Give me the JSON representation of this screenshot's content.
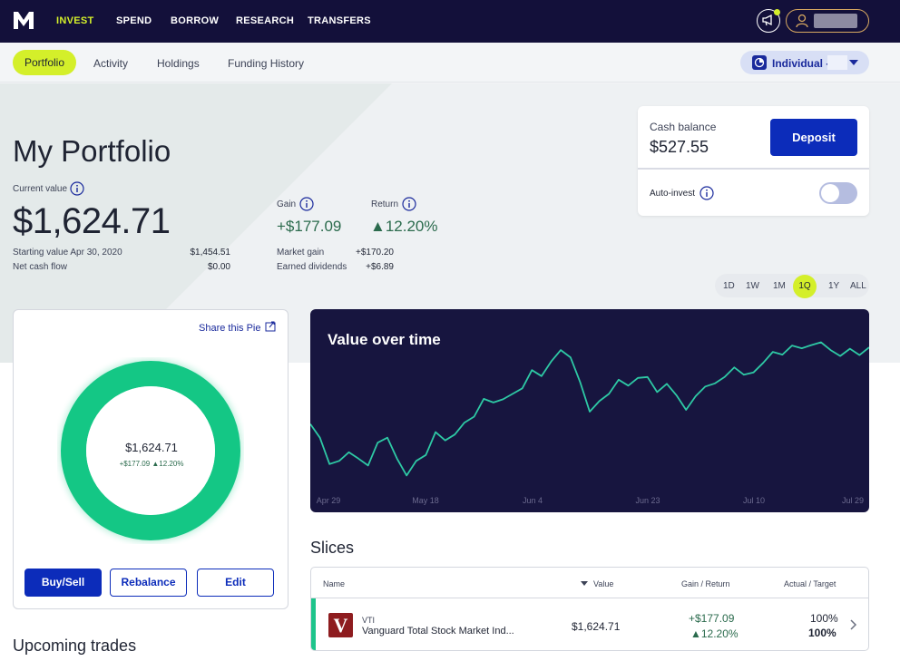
{
  "nav": {
    "logo": "M",
    "items": [
      "INVEST",
      "SPEND",
      "BORROW",
      "RESEARCH",
      "TRANSFERS"
    ],
    "accent": "#d4ef2a",
    "background": "#13103a"
  },
  "subnav": {
    "tabs": [
      "Portfolio",
      "Activity",
      "Holdings",
      "Funding History"
    ],
    "account": "Individual -"
  },
  "portfolio": {
    "title": "My Portfolio",
    "current_value_label": "Current value",
    "current_value": "$1,624.71",
    "starting_label": "Starting value Apr 30, 2020",
    "starting_value": "$1,454.51",
    "net_cash_label": "Net cash flow",
    "net_cash_value": "$0.00",
    "gain_label": "Gain",
    "gain_value": "+$177.09",
    "return_label": "Return",
    "return_value": "▲12.20%",
    "market_gain_label": "Market gain",
    "market_gain_value": "+$170.20",
    "dividends_label": "Earned dividends",
    "dividends_value": "+$6.89"
  },
  "cash": {
    "label": "Cash balance",
    "value": "$527.55",
    "deposit": "Deposit",
    "auto_invest": "Auto-invest",
    "auto_invest_on": false
  },
  "range": {
    "options": [
      "1D",
      "1W",
      "1M",
      "1Q",
      "1Y",
      "ALL"
    ],
    "selected": "1Q"
  },
  "pie": {
    "share": "Share this Pie",
    "center_value": "$1,624.71",
    "center_sub": "+$177.09 ▲12.20%",
    "buttons": [
      "Buy/Sell",
      "Rebalance",
      "Edit"
    ],
    "ring_color": "#14c785"
  },
  "chart_data": {
    "type": "line",
    "title": "Value over time",
    "x_ticks": [
      "Apr 29",
      "May 18",
      "Jun 4",
      "Jun 23",
      "Jul 10",
      "Jul 29"
    ],
    "y": [
      1518,
      1488,
      1430,
      1437,
      1456,
      1442,
      1427,
      1477,
      1488,
      1442,
      1405,
      1437,
      1450,
      1500,
      1482,
      1495,
      1521,
      1534,
      1573,
      1565,
      1572,
      1584,
      1596,
      1636,
      1623,
      1655,
      1680,
      1664,
      1610,
      1545,
      1568,
      1584,
      1615,
      1602,
      1619,
      1621,
      1588,
      1606,
      1581,
      1549,
      1579,
      1600,
      1607,
      1621,
      1642,
      1626,
      1631,
      1652,
      1676,
      1670,
      1690,
      1684,
      1691,
      1697,
      1680,
      1667,
      1683,
      1669,
      1686
    ],
    "ylim": [
      1380,
      1710
    ],
    "line_color": "#2ec9a5",
    "background": "#17153f"
  },
  "slices": {
    "title": "Slices",
    "headers": [
      "Name",
      "Value",
      "Gain / Return",
      "Actual / Target"
    ],
    "rows": [
      {
        "logo": "V",
        "ticker": "VTI",
        "name": "Vanguard Total Stock Market Ind...",
        "value": "$1,624.71",
        "gain": "+$177.09",
        "return": "▲12.20%",
        "actual": "100%",
        "target": "100%"
      }
    ]
  },
  "upcoming": "Upcoming trades"
}
